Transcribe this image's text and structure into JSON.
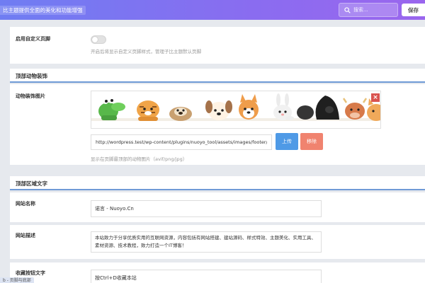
{
  "header": {
    "title": "比主题提供全面的美化和功能增强",
    "search_placeholder": "搜索...",
    "save_label": "保存",
    "search_icon": "search-icon"
  },
  "custom_footer": {
    "label": "启用自定义页脚",
    "enabled": false,
    "description": "开启后将显示自定义页脚样式，管理子比主题默认页脚"
  },
  "section_animals": {
    "title": "顶部动物装饰"
  },
  "animal_image": {
    "label": "动物装饰图片",
    "url": "http://wordpress.test/wp-content/plugins/nuoyo_tool/assets/images/footer/footer",
    "upload_label": "上传",
    "remove_label": "移除",
    "remove_icon": "×",
    "description": "显示在页脚最顶部的动物图片（avif/png/jpg）"
  },
  "section_text": {
    "title": "顶部区域文字"
  },
  "site_name": {
    "label": "网站名称",
    "value": "诺言 - Nuoyo.Cn"
  },
  "site_desc": {
    "label": "网站描述",
    "value": "本站致力于分享优质实用的互联网资源，内容包括有网站搭建、建站源码、样式特效、主题美化、实用工具、素材资源、技术教程，致力打造一个IT博客！"
  },
  "fav_text": {
    "label": "收藏按钮文字",
    "value": "按Ctrl+D收藏本站"
  },
  "left_chip": {
    "text": "b - 页脚与底部"
  },
  "colors": {
    "header_start": "#6f7df2",
    "header_end": "#9a66ee",
    "upload": "#4f9ae6",
    "remove": "#f0836f",
    "accent_line": "#6f9ad6"
  }
}
